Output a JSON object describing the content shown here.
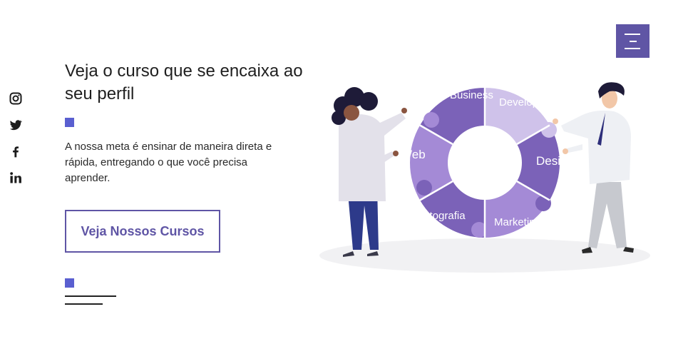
{
  "social": {
    "items": [
      {
        "icon": "instagram-icon"
      },
      {
        "icon": "twitter-icon"
      },
      {
        "icon": "facebook-icon"
      },
      {
        "icon": "linkedin-icon"
      }
    ]
  },
  "menu": {
    "icon": "menu-icon"
  },
  "hero": {
    "title": "Veja o curso que se encaixa ao seu perfil",
    "description": "A nossa meta é ensinar de maneira direta e rápida, entregando o que você precisa aprender.",
    "cta_label": "Veja Nossos Cursos"
  },
  "illustration": {
    "segments": [
      "Business",
      "Developer",
      "Design",
      "Marketing",
      "Fotografia",
      "Web"
    ]
  },
  "colors": {
    "accent": "#5f55a5",
    "square": "#5a5fd0",
    "wheel_dark": "#7b62b8",
    "wheel_mid": "#a48ad6",
    "wheel_light": "#cfc2ea"
  }
}
